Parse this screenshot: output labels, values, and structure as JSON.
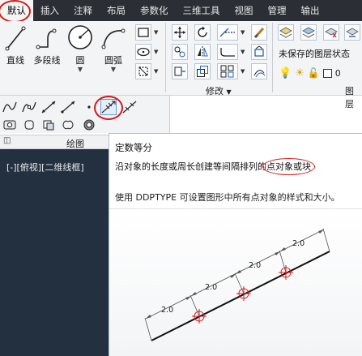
{
  "menu": {
    "items": [
      {
        "label": "默认",
        "active": true
      },
      {
        "label": "插入"
      },
      {
        "label": "注释"
      },
      {
        "label": "布局"
      },
      {
        "label": "参数化"
      },
      {
        "label": "三维工具"
      },
      {
        "label": "视图"
      },
      {
        "label": "管理"
      },
      {
        "label": "输出"
      }
    ]
  },
  "ribbon": {
    "draw_tools": [
      {
        "label": "直线",
        "icon": "line-icon"
      },
      {
        "label": "多段线",
        "icon": "polyline-icon"
      },
      {
        "label": "圆",
        "icon": "circle-icon"
      },
      {
        "label": "圆弧",
        "icon": "arc-icon"
      }
    ],
    "modify_panel_title": "修改",
    "layers": {
      "unsaved_state": "未保存的图层状态",
      "current_layer": "0",
      "panel_title": "图层"
    }
  },
  "flyout": {
    "draw_panel_title": "绘图",
    "active_tool": "divide-icon"
  },
  "viewport": {
    "label": "[-][俯视][二维线框]"
  },
  "tooltip": {
    "title": "定数等分",
    "description_prefix": "沿对象的长度或周长创建等间隔排列的",
    "description_highlight": "点对象或块",
    "tip": "使用 DDPTYPE 可设置图形中所有点对象的样式和大小。",
    "illustration": {
      "segment_labels": [
        "2.0",
        "2.0",
        "2.0",
        "2.0"
      ]
    }
  },
  "colors": {
    "menubar": "#2b2f35",
    "ribbon": "#f3f4f6",
    "viewport": "#233040",
    "highlight_ring": "#d21a1a"
  }
}
